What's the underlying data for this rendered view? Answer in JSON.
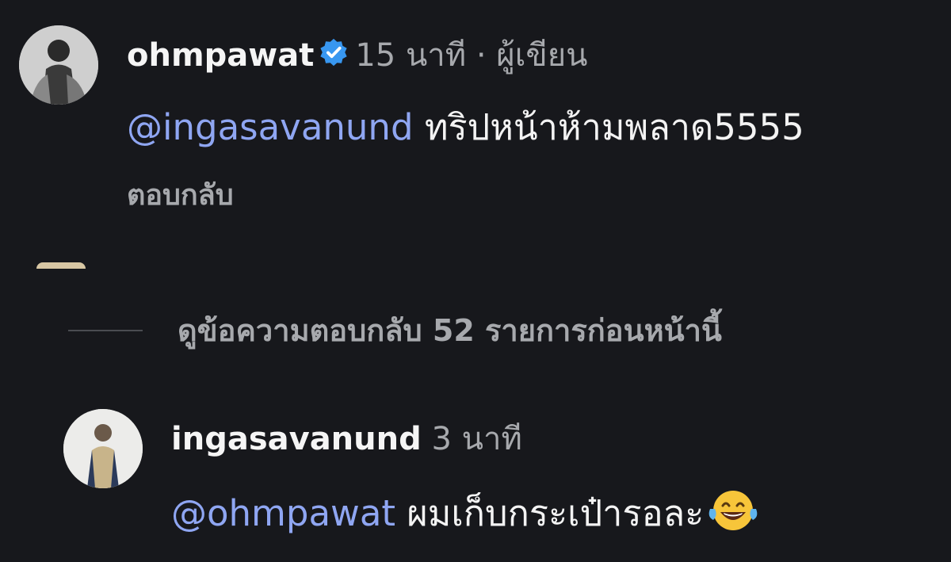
{
  "comments": [
    {
      "username": "ohmpawat",
      "verified": true,
      "time": "15 นาที",
      "separator": "·",
      "role": "ผู้เขียน",
      "mention": "@ingasavanund",
      "text": "ทริปหน้าห้ามพลาด5555",
      "reply_label": "ตอบกลับ",
      "avatar_icon": "profile-photo"
    },
    {
      "username": "ingasavanund",
      "time": "3 นาที",
      "mention": "@ohmpawat",
      "text": "ผมเก็บกระเป๋ารอละ",
      "emoji": "face-with-tears-of-joy",
      "avatar_icon": "profile-photo"
    }
  ],
  "view_more_replies": "ดูข้อความตอบกลับ 52 รายการก่อนหน้านี้",
  "colors": {
    "background": "#17181c",
    "mention": "#8fa6f2",
    "muted": "#a7a9ad",
    "verified": "#3897f0"
  }
}
